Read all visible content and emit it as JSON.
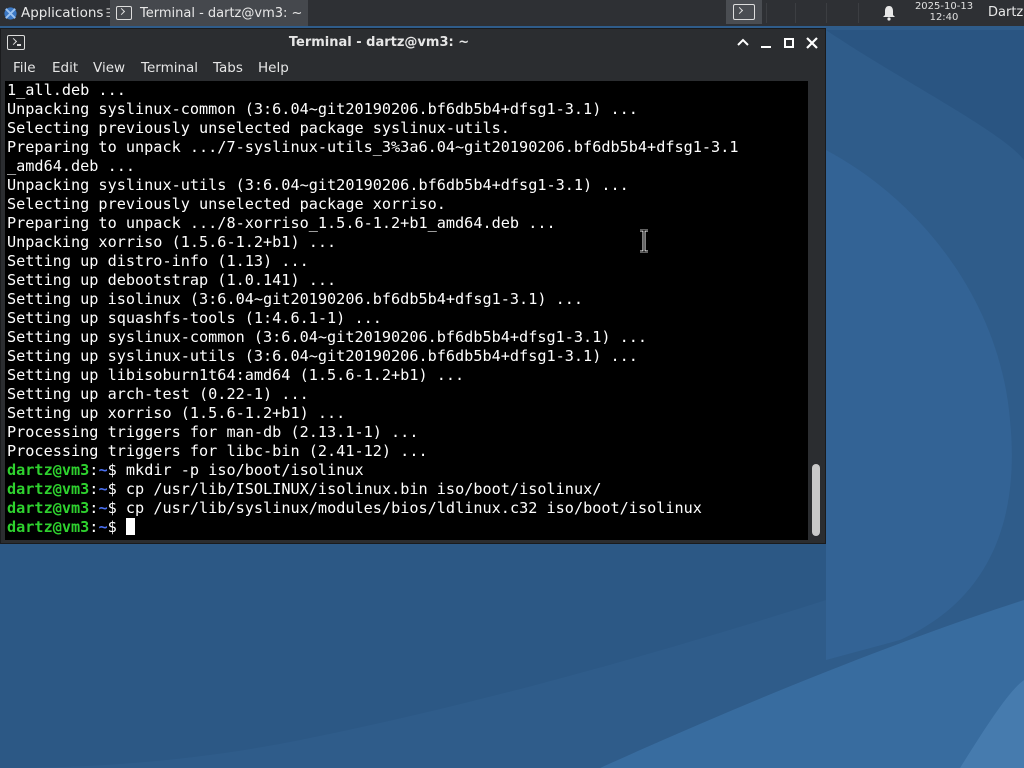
{
  "panel": {
    "applications_label": "Applications",
    "applications_sep": "☰",
    "task_title": "Terminal - dartz@vm3: ~",
    "clock_date": "2025-10-13",
    "clock_time": "12:40",
    "user": "Dartz"
  },
  "window": {
    "title": "Terminal - dartz@vm3: ~",
    "menu": [
      "File",
      "Edit",
      "View",
      "Terminal",
      "Tabs",
      "Help"
    ]
  },
  "terminal": {
    "output": [
      "1_all.deb ...",
      "Unpacking syslinux-common (3:6.04~git20190206.bf6db5b4+dfsg1-3.1) ...",
      "Selecting previously unselected package syslinux-utils.",
      "Preparing to unpack .../7-syslinux-utils_3%3a6.04~git20190206.bf6db5b4+dfsg1-3.1",
      "_amd64.deb ...",
      "Unpacking syslinux-utils (3:6.04~git20190206.bf6db5b4+dfsg1-3.1) ...",
      "Selecting previously unselected package xorriso.",
      "Preparing to unpack .../8-xorriso_1.5.6-1.2+b1_amd64.deb ...",
      "Unpacking xorriso (1.5.6-1.2+b1) ...",
      "Setting up distro-info (1.13) ...",
      "Setting up debootstrap (1.0.141) ...",
      "Setting up isolinux (3:6.04~git20190206.bf6db5b4+dfsg1-3.1) ...",
      "Setting up squashfs-tools (1:4.6.1-1) ...",
      "Setting up syslinux-common (3:6.04~git20190206.bf6db5b4+dfsg1-3.1) ...",
      "Setting up syslinux-utils (3:6.04~git20190206.bf6db5b4+dfsg1-3.1) ...",
      "Setting up libisoburn1t64:amd64 (1.5.6-1.2+b1) ...",
      "Setting up arch-test (0.22-1) ...",
      "Setting up xorriso (1.5.6-1.2+b1) ...",
      "Processing triggers for man-db (2.13.1-1) ...",
      "Processing triggers for libc-bin (2.41-12) ..."
    ],
    "prompt_user": "dartz@vm3",
    "prompt_colon": ":",
    "prompt_path": "~",
    "prompt_symbol": "$ ",
    "commands": [
      "mkdir -p iso/boot/isolinux",
      "cp /usr/lib/ISOLINUX/isolinux.bin iso/boot/isolinux/",
      "cp /usr/lib/syslinux/modules/bios/ldlinux.c32 iso/boot/isolinux",
      ""
    ]
  },
  "colors": {
    "prompt_user": "#2ed12e",
    "prompt_path": "#4a6ff0",
    "terminal_bg": "#000000",
    "terminal_fg": "#ffffff"
  }
}
